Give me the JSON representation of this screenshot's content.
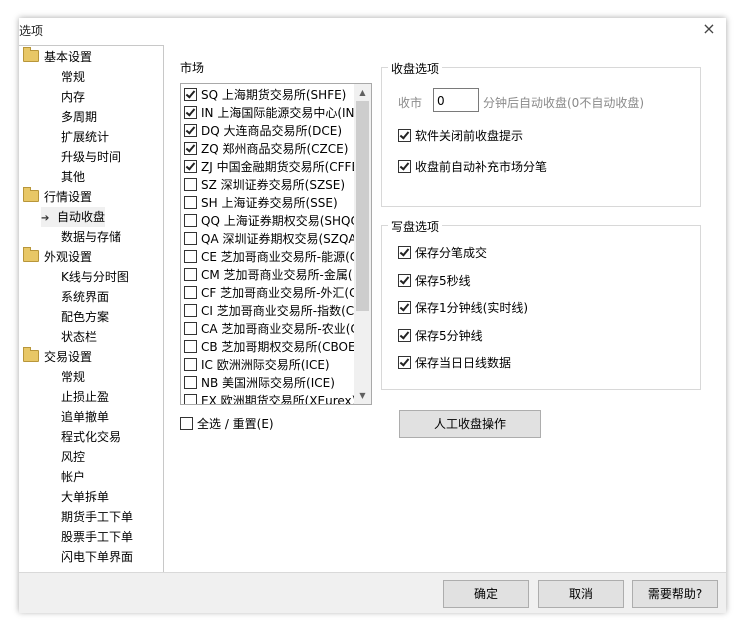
{
  "window": {
    "title": "选项",
    "close_glyph": "×"
  },
  "tree": {
    "items": [
      {
        "label": "基本设置",
        "type": "folder"
      },
      {
        "label": "常规",
        "type": "child"
      },
      {
        "label": "内存",
        "type": "child"
      },
      {
        "label": "多周期",
        "type": "child"
      },
      {
        "label": "扩展统计",
        "type": "child"
      },
      {
        "label": "升级与时间",
        "type": "child"
      },
      {
        "label": "其他",
        "type": "child"
      },
      {
        "label": "行情设置",
        "type": "folder"
      },
      {
        "label": "自动收盘",
        "type": "selected"
      },
      {
        "label": "数据与存储",
        "type": "child"
      },
      {
        "label": "外观设置",
        "type": "folder"
      },
      {
        "label": "K线与分时图",
        "type": "child"
      },
      {
        "label": "系统界面",
        "type": "child"
      },
      {
        "label": "配色方案",
        "type": "child"
      },
      {
        "label": "状态栏",
        "type": "child"
      },
      {
        "label": "交易设置",
        "type": "folder"
      },
      {
        "label": "常规",
        "type": "child"
      },
      {
        "label": "止损止盈",
        "type": "child"
      },
      {
        "label": "追单撤单",
        "type": "child"
      },
      {
        "label": "程式化交易",
        "type": "child"
      },
      {
        "label": "风控",
        "type": "child"
      },
      {
        "label": "帐户",
        "type": "child"
      },
      {
        "label": "大单拆单",
        "type": "child"
      },
      {
        "label": "期货手工下单",
        "type": "child"
      },
      {
        "label": "股票手工下单",
        "type": "child"
      },
      {
        "label": "闪电下单界面",
        "type": "child"
      }
    ]
  },
  "market": {
    "label": "市场",
    "items": [
      {
        "text": "SQ 上海期货交易所(SHFE)",
        "checked": true
      },
      {
        "text": "IN 上海国际能源交易中心(IN",
        "checked": true
      },
      {
        "text": "DQ 大连商品交易所(DCE)",
        "checked": true
      },
      {
        "text": "ZQ 郑州商品交易所(CZCE)",
        "checked": true
      },
      {
        "text": "ZJ 中国金融期货交易所(CFFE",
        "checked": true
      },
      {
        "text": "SZ 深圳证券交易所(SZSE)",
        "checked": false
      },
      {
        "text": "SH 上海证券交易所(SSE)",
        "checked": false
      },
      {
        "text": "QQ 上海证券期权交易(SHQO",
        "checked": false
      },
      {
        "text": "QA 深圳证券期权交易(SZQA",
        "checked": false
      },
      {
        "text": "CE 芝加哥商业交易所-能源(C",
        "checked": false
      },
      {
        "text": "CM 芝加哥商业交易所-金属(",
        "checked": false
      },
      {
        "text": "CF 芝加哥商业交易所-外汇(C",
        "checked": false
      },
      {
        "text": "CI 芝加哥商业交易所-指数(C",
        "checked": false
      },
      {
        "text": "CA 芝加哥商业交易所-农业(C",
        "checked": false
      },
      {
        "text": "CB 芝加哥期权交易所(CBOE",
        "checked": false
      },
      {
        "text": "IC 欧洲洲际交易所(ICE)",
        "checked": false
      },
      {
        "text": "NB 美国洲际交易所(ICE)",
        "checked": false
      },
      {
        "text": "EX 欧洲期货交易所(XEurex)",
        "checked": false
      }
    ],
    "select_all": "全选 / 重置(E)",
    "scroll_up": "▲",
    "scroll_down": "▼"
  },
  "close_options": {
    "title": "收盘选项",
    "close_label": "收市",
    "close_value": "0",
    "close_suffix": "分钟后自动收盘(0不自动收盘)",
    "opt1": "软件关闭前收盘提示",
    "opt2": "收盘前自动补充市场分笔"
  },
  "write_options": {
    "title": "写盘选项",
    "items": [
      "保存分笔成交",
      "保存5秒线",
      "保存1分钟线(实时线)",
      "保存5分钟线",
      "保存当日日线数据"
    ]
  },
  "manual_button": "人工收盘操作",
  "footer": {
    "ok": "确定",
    "cancel": "取消",
    "help": "需要帮助?"
  }
}
